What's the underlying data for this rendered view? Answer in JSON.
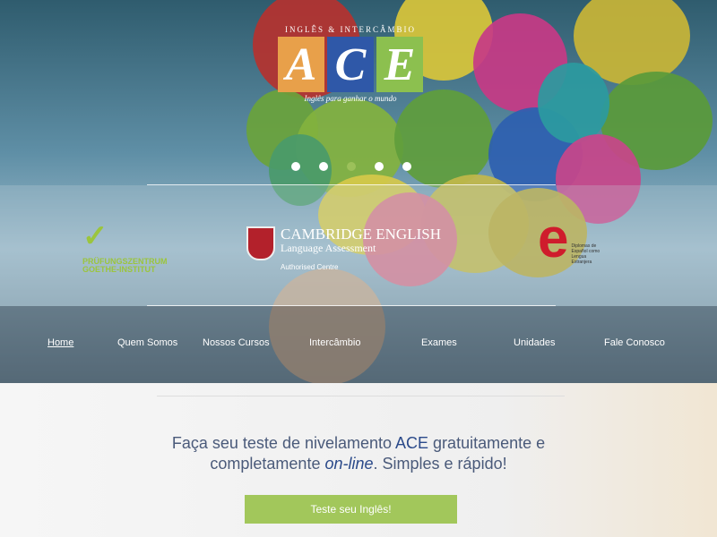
{
  "logo": {
    "top": "INGLÊS & INTERCÂMBIO",
    "letters": [
      "A",
      "C",
      "E"
    ],
    "tagline": "Inglês para ganhar o mundo"
  },
  "carousel": {
    "slides": 5,
    "active_index": 2
  },
  "partners": {
    "goethe": {
      "line1": "PRÜFUNGSZENTRUM",
      "line2": "GOETHE-INSTITUT"
    },
    "cambridge": {
      "title": "CAMBRIDGE ENGLISH",
      "subtitle": "Language Assessment",
      "note": "Authorised Centre"
    },
    "dele": {
      "letter": "e",
      "text": "Diplomas de Español como Lengua Extranjera"
    }
  },
  "nav": {
    "items": [
      {
        "label": "Home",
        "active": true
      },
      {
        "label": "Quem Somos"
      },
      {
        "label": "Nossos Cursos"
      },
      {
        "label": "Intercâmbio"
      },
      {
        "label": "Exames"
      },
      {
        "label": "Unidades"
      },
      {
        "label": "Fale Conosco"
      }
    ]
  },
  "promo": {
    "t1": "Faça seu teste de nivelamento ",
    "t2": "ACE",
    "t3": " gratuitamente e",
    "t4": "completamente ",
    "t5": "on-line",
    "t6": ". Simples e rápido!",
    "button": "Teste seu Inglês!"
  },
  "colors": {
    "accent": "#a2c75b",
    "ace_orange": "#e8a04a",
    "ace_blue": "#2f58a8",
    "ace_green": "#8cc04f"
  }
}
